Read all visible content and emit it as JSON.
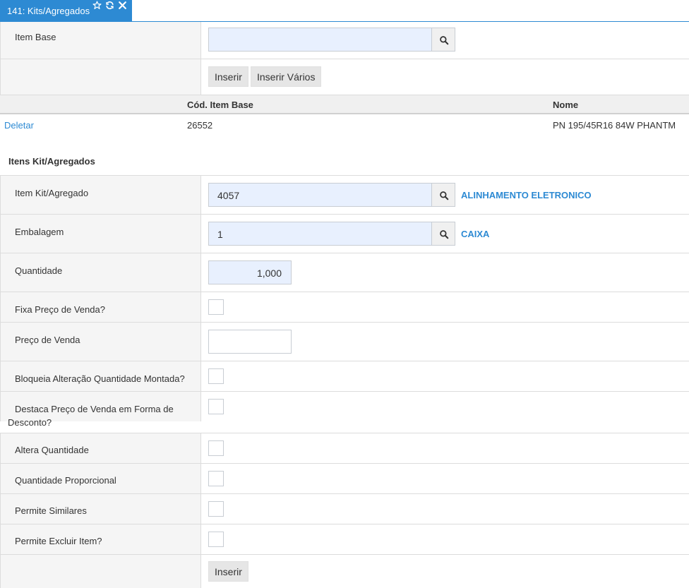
{
  "tab": {
    "title": "141: Kits/Agregados",
    "icons": [
      "star-icon",
      "refresh-icon",
      "close-icon"
    ]
  },
  "item_base": {
    "label": "Item Base",
    "value": "",
    "insert_label": "Inserir",
    "insert_many_label": "Inserir Vários"
  },
  "table": {
    "columns": [
      "",
      "Cód. Item Base",
      "Nome"
    ],
    "rows": [
      {
        "action": "Deletar",
        "code": "26552",
        "name": "PN 195/45R16 84W PHANTM"
      }
    ]
  },
  "kit": {
    "section_title": "Itens Kit/Agregados",
    "item_label": "Item Kit/Agregado",
    "item_value": "4057",
    "item_desc": "ALINHAMENTO ELETRONICO",
    "pack_label": "Embalagem",
    "pack_value": "1",
    "pack_desc": "CAIXA",
    "qty_label": "Quantidade",
    "qty_value": "1,000",
    "fix_price_label": "Fixa Preço de Venda?",
    "price_label": "Preço de Venda",
    "price_value": "",
    "lock_qty_label": "Bloqueia Alteração Quantidade Montada?",
    "discount_label_1": "Destaca Preço de Venda em Forma de",
    "discount_label_2": "Desconto?",
    "alter_qty_label": "Altera Quantidade",
    "prop_qty_label": "Quantidade Proporcional",
    "similar_label": "Permite Similares",
    "exclude_label": "Permite Excluir Item?",
    "insert_label": "Inserir"
  },
  "colors": {
    "accent": "#2d8ad3",
    "input_bg": "#e8f0fe",
    "label_bg": "#f5f5f5"
  }
}
